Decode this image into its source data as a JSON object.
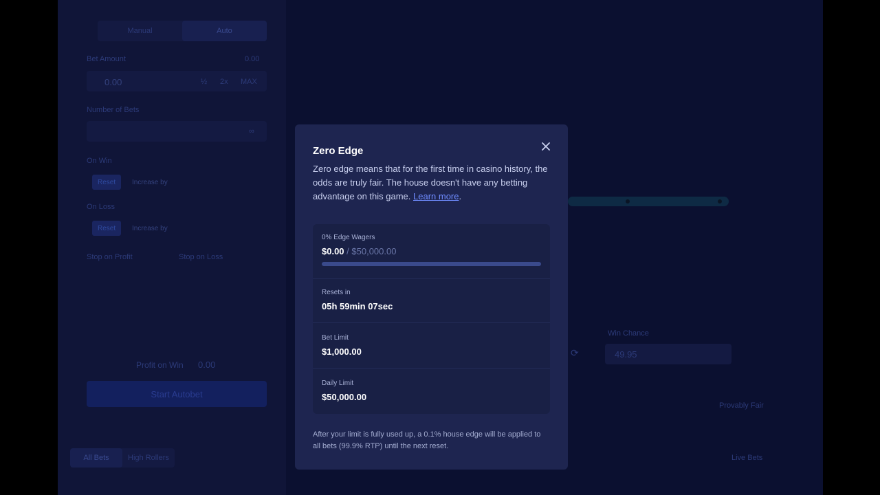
{
  "background": {
    "mode_tabs": [
      "Manual",
      "Auto"
    ],
    "bet_amount_label": "Bet Amount",
    "bet_amount_side": "0.00",
    "bet_amount_value": "0.00",
    "bet_buttons": [
      "½",
      "2x",
      "MAX"
    ],
    "number_of_bets_label": "Number of Bets",
    "infinity": "∞",
    "on_win_label": "On Win",
    "on_loss_label": "On Loss",
    "reset_label": "Reset",
    "increase_by_label": "Increase by",
    "stop_on_profit_label": "Stop on Profit",
    "stop_on_loss_label": "Stop on Loss",
    "profit_on_win_label": "Profit on Win",
    "profit_on_win_value": "0.00",
    "start_autobet_label": "Start Autobet",
    "win_chance_label": "Win Chance",
    "win_chance_value": "49.95",
    "bottom_tabs": [
      "All Bets",
      "High Rollers"
    ],
    "live_bets_label": "Live Bets",
    "fairness_label": "Provably Fair"
  },
  "modal": {
    "title": "Zero Edge",
    "description": "Zero edge means that for the first time in casino history, the odds are truly fair. The house doesn't have any betting advantage on this game.",
    "learn_more": "Learn more",
    "stats": {
      "wagers_label": "0% Edge Wagers",
      "wagers_value": "$0.00",
      "wagers_limit": "/ $50,000.00",
      "wagers_progress": 0,
      "resets_label": "Resets in",
      "resets_value": "05h 59min 07sec",
      "bet_limit_label": "Bet Limit",
      "bet_limit_value": "$1,000.00",
      "daily_limit_label": "Daily Limit",
      "daily_limit_value": "$50,000.00"
    },
    "footnote": "After your limit is fully used up, a 0.1% house edge will be applied to all bets (99.9% RTP) until the next reset."
  }
}
